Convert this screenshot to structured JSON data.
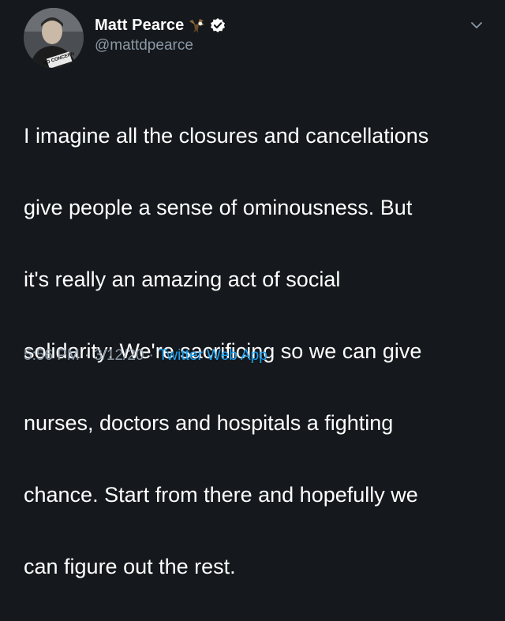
{
  "author": {
    "display_name": "Matt Pearce",
    "handle": "@mattdpearce",
    "avatar_shirt_text": "NO CONCERN"
  },
  "tweet": {
    "lines": [
      "I imagine all the closures and cancellations",
      "give people a sense of ominousness. But",
      "it's really an amazing act of social",
      "solidarity: We're sacrificing so we can give",
      "nurses, doctors and hospitals a fighting",
      "chance. Start from there and hopefully we",
      "can figure out the rest."
    ]
  },
  "meta": {
    "time": "5:56 PM",
    "date": "3/12/20",
    "separator": "·",
    "source": "Twitter Web App"
  },
  "colors": {
    "background": "#15181c",
    "text": "#ffffff",
    "secondary_text": "#8b98a5",
    "link": "#1da1f2"
  },
  "icons": {
    "bird_emoji": "eagle-icon",
    "verified": "verified-badge-icon",
    "more": "chevron-down-icon"
  }
}
